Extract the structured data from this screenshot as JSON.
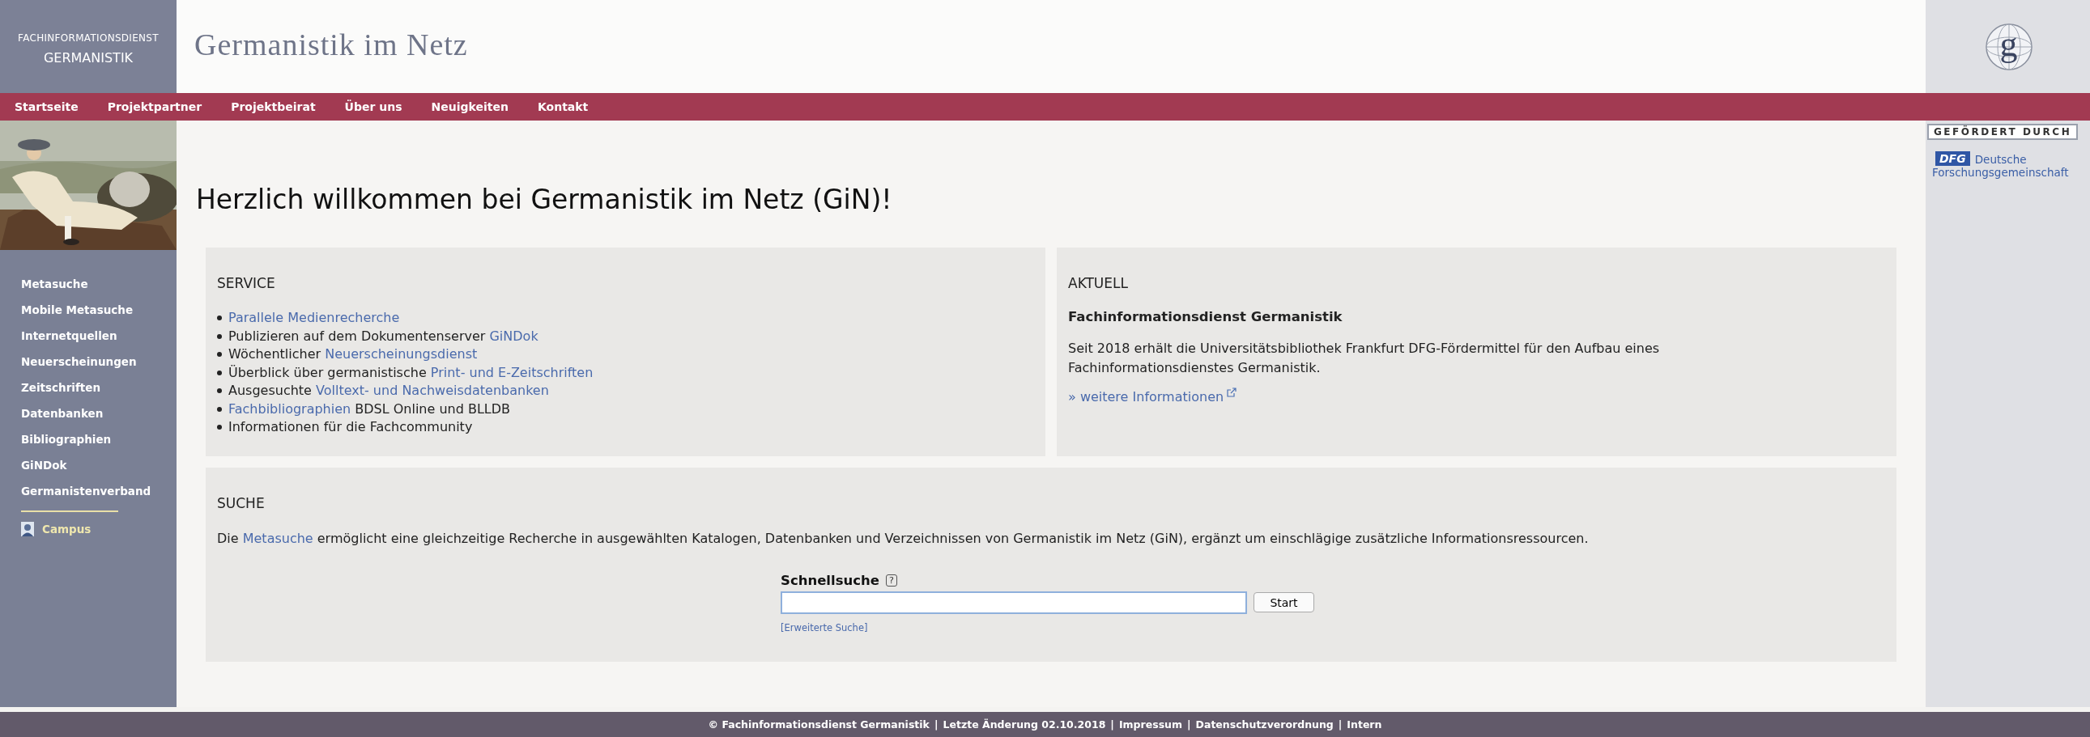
{
  "brand": {
    "line1": "FACHINFORMATIONSDIENST",
    "line2": "GERMANISTIK",
    "title": "Germanistik im Netz",
    "logo_letter": "g"
  },
  "nav": [
    "Startseite",
    "Projektpartner",
    "Projektbeirat",
    "Über uns",
    "Neuigkeiten",
    "Kontakt"
  ],
  "sidebar": {
    "items": [
      "Metasuche",
      "Mobile Metasuche",
      "Internetquellen",
      "Neuerscheinungen",
      "Zeitschriften",
      "Datenbanken",
      "Bibliographien",
      "GiNDok",
      "Germanistenverband"
    ],
    "campus": "Campus"
  },
  "sponsor": {
    "heading": "GEFÖRDERT DURCH",
    "logo_text": "DFG",
    "name_line1": "Deutsche",
    "name_line2": "Forschungsgemeinschaft"
  },
  "heading": "Herzlich willkommen bei Germanistik im Netz (GiN)!",
  "service": {
    "title": "SERVICE",
    "items": [
      [
        {
          "text": "Parallele Medienrecherche",
          "link": true
        }
      ],
      [
        {
          "text": "Publizieren auf dem Dokumentenserver ",
          "link": false
        },
        {
          "text": "GiNDok",
          "link": true
        }
      ],
      [
        {
          "text": "Wöchentlicher ",
          "link": false
        },
        {
          "text": "Neuerscheinungsdienst",
          "link": true
        }
      ],
      [
        {
          "text": "Überblick über germanistische ",
          "link": false
        },
        {
          "text": "Print- und E-Zeitschriften",
          "link": true
        }
      ],
      [
        {
          "text": "Ausgesuchte ",
          "link": false
        },
        {
          "text": "Volltext- und Nachweisdatenbanken",
          "link": true
        }
      ],
      [
        {
          "text": "Fachbibliographien",
          "link": true
        },
        {
          "text": " BDSL Online und BLLDB",
          "link": false
        }
      ],
      [
        {
          "text": "Informationen für die Fachcommunity",
          "link": false
        }
      ]
    ]
  },
  "news": {
    "title": "AKTUELL",
    "headline": "Fachinformationsdienst Germanistik",
    "text": "Seit 2018 erhält die Universitätsbibliothek Frankfurt DFG-Fördermittel für den Aufbau eines Fachinformationsdienstes Germanistik.",
    "more": "» weitere Informationen"
  },
  "search": {
    "title": "SUCHE",
    "intro": [
      {
        "text": "Die ",
        "link": false
      },
      {
        "text": "Metasuche",
        "link": true
      },
      {
        "text": " ermöglicht eine gleichzeitige Recherche in ausgewählten Katalogen, Datenbanken und Verzeichnissen von Germanistik im Netz (GiN), ergänzt um einschlägige zusätzliche Informationsressourcen.",
        "link": false
      }
    ],
    "label": "Schnellsuche",
    "help": "?",
    "button": "Start",
    "advanced": "[Erweiterte Suche]"
  },
  "footer": {
    "separator": "|",
    "items": [
      "© Fachinformationsdienst Germanistik",
      "Letzte Änderung 02.10.2018",
      "Impressum",
      "Datenschutzverordnung",
      "Intern"
    ]
  }
}
